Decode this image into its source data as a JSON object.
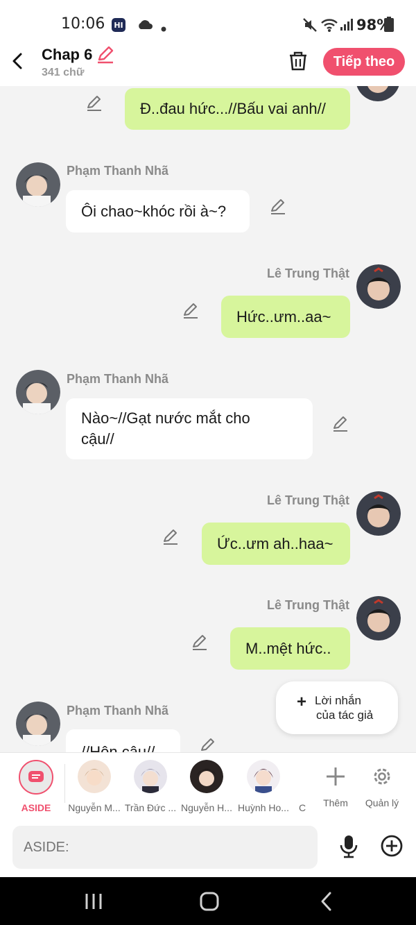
{
  "status_bar": {
    "time": "10:06",
    "battery": "98%"
  },
  "header": {
    "title": "Chap 6",
    "subtitle": "341 chữ",
    "next_label": "Tiếp theo"
  },
  "messages": [
    {
      "side": "right",
      "speaker": "",
      "text": "Đ..đau hức...//Bấu vai anh//"
    },
    {
      "side": "left",
      "speaker": "Phạm Thanh Nhã",
      "text": "Ôi chao~khóc rồi à~?"
    },
    {
      "side": "right",
      "speaker": "Lê Trung Thật",
      "text": "Hức..ưm..aa~"
    },
    {
      "side": "left",
      "speaker": "Phạm Thanh Nhã",
      "text_line1": "Nào~//Gạt nước mắt cho",
      "text_line2": "cậu//"
    },
    {
      "side": "right",
      "speaker": "Lê Trung Thật",
      "text": "Ức..ưm ah..haa~"
    },
    {
      "side": "right",
      "speaker": "Lê Trung Thật",
      "text": "M..mệt hức.."
    },
    {
      "side": "left",
      "speaker": "Phạm Thanh Nhã",
      "text": "//Hôn cậu//"
    }
  ],
  "author_note": {
    "line1": "Lời nhắn",
    "line2": "của tác giả"
  },
  "characters": [
    {
      "label": "ASIDE"
    },
    {
      "label": "Nguyễn M..."
    },
    {
      "label": "Trần Đức ..."
    },
    {
      "label": "Nguyễn H..."
    },
    {
      "label": "Huỳnh Ho..."
    },
    {
      "label": "C"
    }
  ],
  "actions": {
    "add_label": "Thêm",
    "manage_label": "Quản lý"
  },
  "input": {
    "placeholder": "ASIDE:"
  },
  "colors": {
    "accent": "#f0506e",
    "green_bubble": "#d7f59c",
    "white_bubble": "#ffffff",
    "background": "#f3f3f3"
  }
}
